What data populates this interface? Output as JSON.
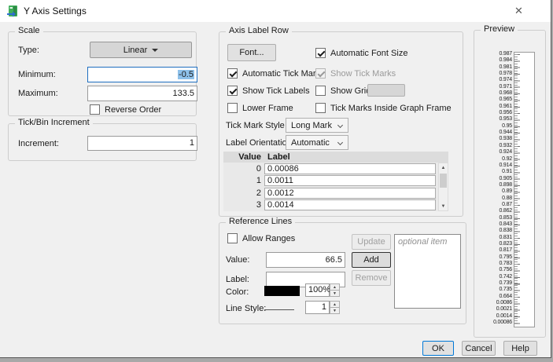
{
  "window": {
    "title": "Y Axis Settings",
    "close_glyph": "✕"
  },
  "scale": {
    "title": "Scale",
    "type_label": "Type:",
    "type_value": "Linear",
    "minimum_label": "Minimum:",
    "minimum_value": "-0.5",
    "maximum_label": "Maximum:",
    "maximum_value": "133.5",
    "reverse_order_label": "Reverse Order",
    "reverse_order_checked": false
  },
  "tick_bin": {
    "title": "Tick/Bin Increment",
    "increment_label": "Increment:",
    "increment_value": "1"
  },
  "axis_label_row": {
    "title": "Axis Label Row",
    "font_button": "Font...",
    "checkboxes": [
      {
        "label": "Automatic Font Size",
        "checked": true,
        "disabled": false
      },
      {
        "label": "Automatic Tick Marks",
        "checked": true,
        "disabled": false
      },
      {
        "label": "Show Tick Marks",
        "checked": true,
        "disabled": true
      },
      {
        "label": "Show Tick Labels",
        "checked": true,
        "disabled": false
      },
      {
        "label": "Show Grid",
        "checked": false,
        "disabled": false
      },
      {
        "label": "Lower Frame",
        "checked": false,
        "disabled": false
      },
      {
        "label": "Tick Marks Inside Graph Frame",
        "checked": false,
        "disabled": false
      }
    ],
    "tick_mark_style_label": "Tick Mark Style",
    "tick_mark_style_value": "Long Mark",
    "label_orientation_label": "Label Orientation",
    "label_orientation_value": "Automatic",
    "table": {
      "headers": [
        "Value",
        "Label"
      ],
      "rows": [
        {
          "value": "0",
          "label": "0.00086"
        },
        {
          "value": "1",
          "label": "0.0011"
        },
        {
          "value": "2",
          "label": "0.0012"
        },
        {
          "value": "3",
          "label": "0.0014"
        }
      ]
    }
  },
  "reference_lines": {
    "title": "Reference Lines",
    "allow_ranges_label": "Allow Ranges",
    "allow_ranges_checked": false,
    "value_label": "Value:",
    "value_value": "66.5",
    "label_label": "Label:",
    "label_value": "",
    "color_label": "Color:",
    "color_value": "#000000",
    "opacity_value": "100%",
    "line_style_label": "Line Style:",
    "line_width_value": "1",
    "update_button": "Update",
    "add_button": "Add",
    "remove_button": "Remove",
    "list_placeholder": "optional item"
  },
  "preview": {
    "title": "Preview",
    "tick_labels": [
      "0.987",
      "0.984",
      "0.981",
      "0.978",
      "0.974",
      "0.971",
      "0.968",
      "0.965",
      "0.961",
      "0.956",
      "0.953",
      "0.95",
      "0.944",
      "0.938",
      "0.932",
      "0.924",
      "0.92",
      "0.914",
      "0.91",
      "0.905",
      "0.898",
      "0.89",
      "0.88",
      "0.87",
      "0.862",
      "0.853",
      "0.843",
      "0.838",
      "0.831",
      "0.823",
      "0.817",
      "0.795",
      "0.783",
      "0.756",
      "0.742",
      "0.739",
      "0.735",
      "0.664",
      "0.0086",
      "0.0021",
      "0.0014",
      "0.00086"
    ]
  },
  "footer": {
    "ok": "OK",
    "cancel": "Cancel",
    "help": "Help"
  },
  "colors": {
    "accent": "#0078d7",
    "selection": "#8ec1ea",
    "swatch_black": "#000000"
  }
}
